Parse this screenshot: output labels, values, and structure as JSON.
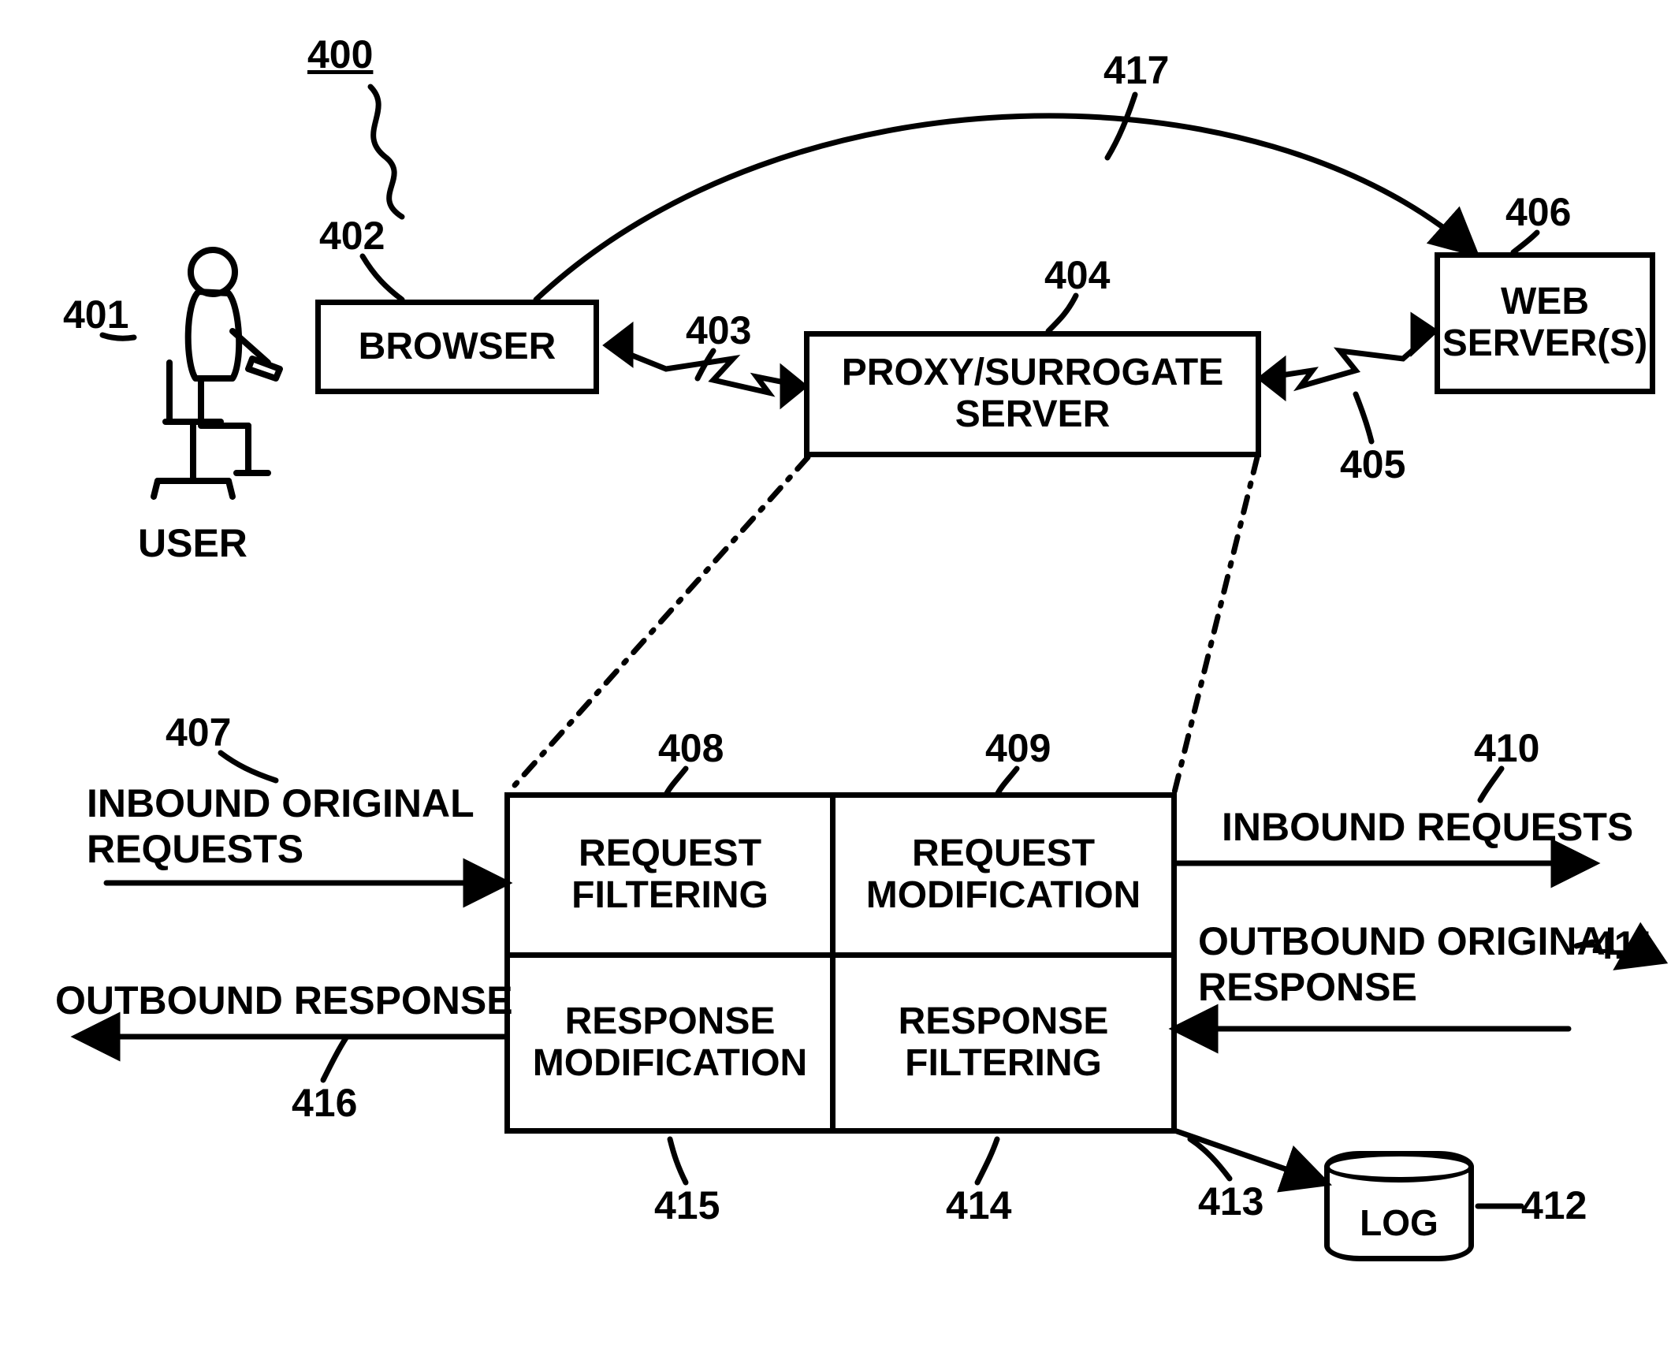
{
  "figure_ref": "400",
  "nodes": {
    "user": {
      "label": "USER",
      "ref": "401"
    },
    "browser": {
      "label": "BROWSER",
      "ref": "402"
    },
    "proxy": {
      "label": "PROXY/SURROGATE\nSERVER",
      "ref": "404"
    },
    "web": {
      "label": "WEB\nSERVER(S)",
      "ref": "406"
    },
    "reqfilt": {
      "label": "REQUEST\nFILTERING",
      "ref": "408"
    },
    "reqmod": {
      "label": "REQUEST\nMODIFICATION",
      "ref": "409"
    },
    "respmod": {
      "label": "RESPONSE\nMODIFICATION",
      "ref": "415"
    },
    "respfilt": {
      "label": "RESPONSE\nFILTERING",
      "ref": "414"
    },
    "log": {
      "label": "LOG",
      "ref": "412"
    }
  },
  "flows": {
    "in_orig": {
      "label": "INBOUND ORIGINAL\nREQUESTS",
      "ref": "407"
    },
    "in_req": {
      "label": "INBOUND REQUESTS",
      "ref": "410"
    },
    "out_orig": {
      "label": "OUTBOUND ORIGINAL\nRESPONSE",
      "ref": "411"
    },
    "out_resp": {
      "label": "OUTBOUND RESPONSE",
      "ref": "416"
    }
  },
  "links": {
    "browser_proxy": {
      "ref": "403"
    },
    "proxy_web": {
      "ref": "405"
    },
    "browser_web": {
      "ref": "417"
    },
    "proxy_log": {
      "ref": "413"
    }
  }
}
